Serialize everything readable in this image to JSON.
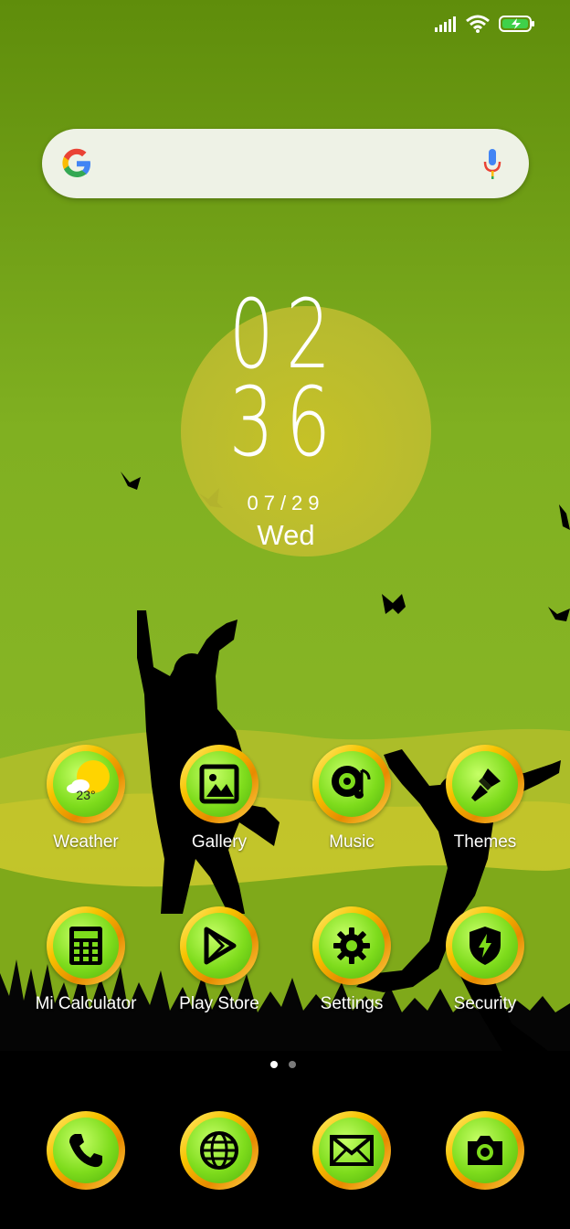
{
  "status_bar": {
    "icons": [
      "signal-icon",
      "wifi-icon",
      "battery-charging-icon"
    ]
  },
  "search": {
    "placeholder": ""
  },
  "clock": {
    "hour": "02",
    "minute": "36",
    "date": "07/29",
    "day": "Wed"
  },
  "apps_row1": [
    {
      "label": "Weather",
      "icon": "weather-icon",
      "temp": "23°"
    },
    {
      "label": "Gallery",
      "icon": "gallery-icon"
    },
    {
      "label": "Music",
      "icon": "music-icon"
    },
    {
      "label": "Themes",
      "icon": "themes-brush-icon"
    }
  ],
  "apps_row2": [
    {
      "label": "Mi Calculator",
      "icon": "calculator-icon"
    },
    {
      "label": "Play Store",
      "icon": "play-store-icon"
    },
    {
      "label": "Settings",
      "icon": "gear-icon"
    },
    {
      "label": "Security",
      "icon": "shield-icon"
    }
  ],
  "dock": [
    {
      "icon": "phone-icon"
    },
    {
      "icon": "browser-globe-icon"
    },
    {
      "icon": "messages-envelope-icon"
    },
    {
      "icon": "camera-icon"
    }
  ],
  "page_indicator": {
    "count": 2,
    "active": 1
  },
  "colors": {
    "accent": "#f7c200",
    "icon_fill": "#7edc1c",
    "sky": "#7cab19"
  }
}
